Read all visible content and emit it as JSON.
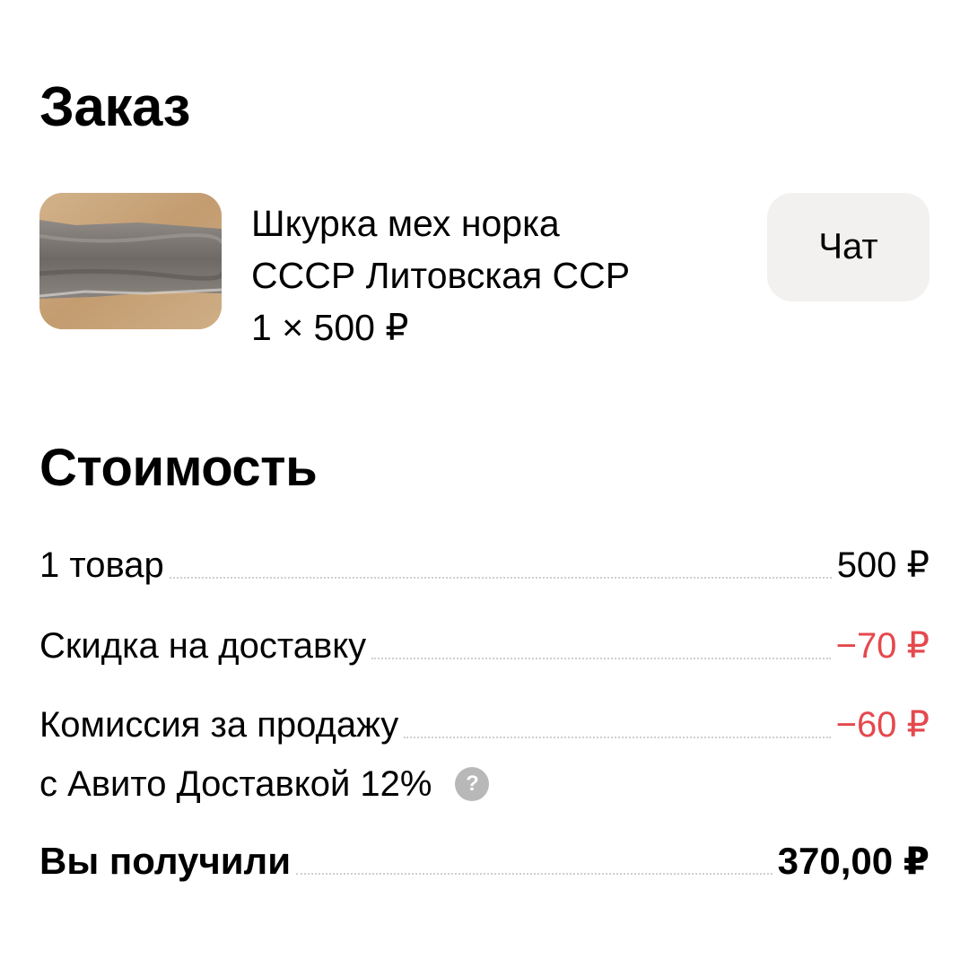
{
  "order": {
    "title": "Заказ",
    "product": {
      "title_line1": "Шкурка мех норка",
      "title_line2": "СССР Литовская ССР",
      "quantity_price": "1 × 500 ₽",
      "image_icon": "fur-pelt-photo"
    },
    "chat_label": "Чат"
  },
  "cost": {
    "title": "Стоимость",
    "rows": [
      {
        "label": "1 товар",
        "value": "500 ₽"
      },
      {
        "label": "Скидка на доставку",
        "value": "−70 ₽"
      },
      {
        "label": "Комиссия за продажу",
        "label_line2": "с Авито Доставкой 12%",
        "value": "−60 ₽"
      }
    ],
    "help_icon_glyph": "?",
    "total": {
      "label": "Вы получили",
      "value": "370,00 ₽"
    },
    "colors": {
      "negative": "#e5484d",
      "chat_bg": "#f2f1f0",
      "help_icon_bg": "#b8b8b8"
    }
  }
}
